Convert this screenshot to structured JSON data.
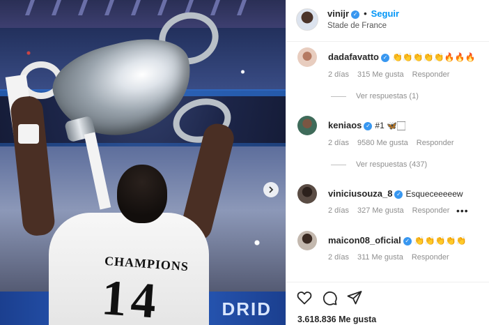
{
  "photo": {
    "jersey_name": "CHAMPIONS",
    "jersey_number": "14",
    "board_text": "DRID",
    "next_icon": "chevron-right-icon"
  },
  "post": {
    "author": "vinijr",
    "separator": "•",
    "follow_label": "Seguir",
    "location": "Stade de France"
  },
  "comments": [
    {
      "user": "dadafavatto",
      "text": "👏👏👏👏👏🔥🔥🔥",
      "time": "2 días",
      "likes": "315 Me gusta",
      "reply_label": "Responder",
      "replies": "Ver respuestas (1)"
    },
    {
      "user": "keniaos",
      "text": "#1 🦋🏻",
      "time": "2 días",
      "likes": "9580 Me gusta",
      "reply_label": "Responder",
      "replies": "Ver respuestas (437)"
    },
    {
      "user": "viniciusouza_8",
      "text": "Esqueceeeeew",
      "time": "2 días",
      "likes": "327 Me gusta",
      "reply_label": "Responder",
      "more": "•••"
    },
    {
      "user": "maicon08_oficial",
      "text": "👏👏👏👏👏",
      "time": "2 días",
      "likes": "311 Me gusta",
      "reply_label": "Responder"
    }
  ],
  "footer": {
    "likes_count": "3.618.836 Me gusta"
  },
  "colors": {
    "accent": "#0095f6",
    "verified": "#3897f0",
    "muted": "#8e8e8e"
  }
}
